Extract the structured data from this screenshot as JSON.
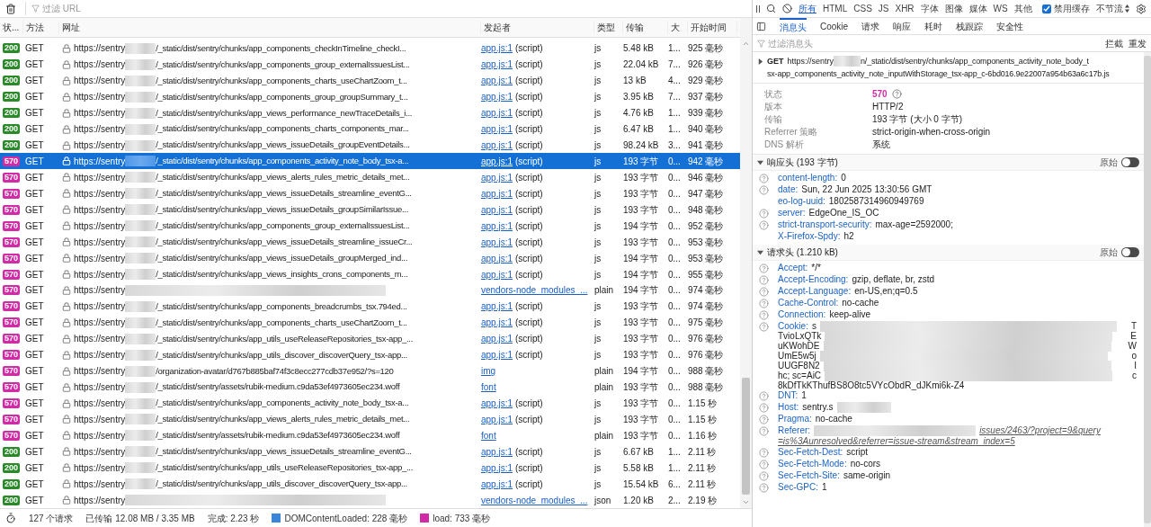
{
  "toolbar": {
    "filter_placeholder": "过滤 URL"
  },
  "columns": [
    "状...",
    "方法",
    "网址",
    "发起者",
    "类型",
    "传输",
    "大",
    "开始时间"
  ],
  "rows": [
    {
      "status": "200",
      "color": "#2a8a2a",
      "method": "GET",
      "url_start": "https://sentry",
      "url_end": "/_static/dist/sentry/chunks/app_components_checkInTimeline_checkI...",
      "initiator": "app.js:1",
      "initiator_note": "(script)",
      "type": "js",
      "transferred": "5.48 kB",
      "size": "1...",
      "start": "925 毫秒",
      "selected": false
    },
    {
      "status": "200",
      "color": "#2a8a2a",
      "method": "GET",
      "url_start": "https://sentry",
      "url_end": "/_static/dist/sentry/chunks/app_components_group_externalIssuesList...",
      "initiator": "app.js:1",
      "initiator_note": "(script)",
      "type": "js",
      "transferred": "22.04 kB",
      "size": "7...",
      "start": "926 毫秒",
      "selected": false
    },
    {
      "status": "200",
      "color": "#2a8a2a",
      "method": "GET",
      "url_start": "https://sentry",
      "url_end": "/_static/dist/sentry/chunks/app_components_charts_useChartZoom_t...",
      "initiator": "app.js:1",
      "initiator_note": "(script)",
      "type": "js",
      "transferred": "13 kB",
      "size": "4...",
      "start": "929 毫秒",
      "selected": false
    },
    {
      "status": "200",
      "color": "#2a8a2a",
      "method": "GET",
      "url_start": "https://sentry",
      "url_end": "/_static/dist/sentry/chunks/app_components_group_groupSummary_t...",
      "initiator": "app.js:1",
      "initiator_note": "(script)",
      "type": "js",
      "transferred": "3.95 kB",
      "size": "7...",
      "start": "937 毫秒",
      "selected": false
    },
    {
      "status": "200",
      "color": "#2a8a2a",
      "method": "GET",
      "url_start": "https://sentry",
      "url_end": "/_static/dist/sentry/chunks/app_views_performance_newTraceDetails_i...",
      "initiator": "app.js:1",
      "initiator_note": "(script)",
      "type": "js",
      "transferred": "4.76 kB",
      "size": "1...",
      "start": "939 毫秒",
      "selected": false
    },
    {
      "status": "200",
      "color": "#2a8a2a",
      "method": "GET",
      "url_start": "https://sentry",
      "url_end": "/_static/dist/sentry/chunks/app_components_charts_components_mar...",
      "initiator": "app.js:1",
      "initiator_note": "(script)",
      "type": "js",
      "transferred": "6.47 kB",
      "size": "1...",
      "start": "940 毫秒",
      "selected": false
    },
    {
      "status": "200",
      "color": "#2a8a2a",
      "method": "GET",
      "url_start": "https://sentry",
      "url_end": "/_static/dist/sentry/chunks/app_views_issueDetails_groupEventDetails...",
      "initiator": "app.js:1",
      "initiator_note": "(script)",
      "type": "js",
      "transferred": "98.24 kB",
      "size": "3...",
      "start": "941 毫秒",
      "selected": false
    },
    {
      "status": "570",
      "color": "#d12ba6",
      "method": "GET",
      "url_start": "https://sentry",
      "url_end": "/_static/dist/sentry/chunks/app_components_activity_note_body_tsx-a...",
      "initiator": "app.js:1",
      "initiator_note": "(script)",
      "type": "js",
      "transferred": "193 字节",
      "size": "0...",
      "start": "942 毫秒",
      "selected": true
    },
    {
      "status": "570",
      "color": "#d12ba6",
      "method": "GET",
      "url_start": "https://sentry",
      "url_end": "/_static/dist/sentry/chunks/app_views_alerts_rules_metric_details_met...",
      "initiator": "app.js:1",
      "initiator_note": "(script)",
      "type": "js",
      "transferred": "193 字节",
      "size": "0...",
      "start": "946 毫秒",
      "selected": false
    },
    {
      "status": "570",
      "color": "#d12ba6",
      "method": "GET",
      "url_start": "https://sentry",
      "url_end": "/_static/dist/sentry/chunks/app_views_issueDetails_streamline_eventG...",
      "initiator": "app.js:1",
      "initiator_note": "(script)",
      "type": "js",
      "transferred": "193 字节",
      "size": "0...",
      "start": "947 毫秒",
      "selected": false
    },
    {
      "status": "570",
      "color": "#d12ba6",
      "method": "GET",
      "url_start": "https://sentry",
      "url_end": "/_static/dist/sentry/chunks/app_views_issueDetails_groupSimilarIssue...",
      "initiator": "app.js:1",
      "initiator_note": "(script)",
      "type": "js",
      "transferred": "193 字节",
      "size": "0...",
      "start": "948 毫秒",
      "selected": false
    },
    {
      "status": "570",
      "color": "#d12ba6",
      "method": "GET",
      "url_start": "https://sentry",
      "url_end": "/_static/dist/sentry/chunks/app_components_group_externalIssuesList...",
      "initiator": "app.js:1",
      "initiator_note": "(script)",
      "type": "js",
      "transferred": "194 字节",
      "size": "0...",
      "start": "952 毫秒",
      "selected": false
    },
    {
      "status": "570",
      "color": "#d12ba6",
      "method": "GET",
      "url_start": "https://sentry",
      "url_end": "/_static/dist/sentry/chunks/app_views_issueDetails_streamline_issueCr...",
      "initiator": "app.js:1",
      "initiator_note": "(script)",
      "type": "js",
      "transferred": "193 字节",
      "size": "0...",
      "start": "953 毫秒",
      "selected": false
    },
    {
      "status": "570",
      "color": "#d12ba6",
      "method": "GET",
      "url_start": "https://sentry",
      "url_end": "/_static/dist/sentry/chunks/app_views_issueDetails_groupMerged_ind...",
      "initiator": "app.js:1",
      "initiator_note": "(script)",
      "type": "js",
      "transferred": "194 字节",
      "size": "0...",
      "start": "953 毫秒",
      "selected": false
    },
    {
      "status": "570",
      "color": "#d12ba6",
      "method": "GET",
      "url_start": "https://sentry",
      "url_end": "/_static/dist/sentry/chunks/app_views_insights_crons_components_m...",
      "initiator": "app.js:1",
      "initiator_note": "(script)",
      "type": "js",
      "transferred": "194 字节",
      "size": "0...",
      "start": "955 毫秒",
      "selected": false
    },
    {
      "status": "570",
      "color": "#d12ba6",
      "method": "GET",
      "url_start": "https://sentry",
      "initiator": "vendors-node_modules_...",
      "type": "plain",
      "transferred": "194 字节",
      "size": "0...",
      "start": "974 毫秒",
      "selected": false
    },
    {
      "status": "570",
      "color": "#d12ba6",
      "method": "GET",
      "url_start": "https://sentry",
      "url_end": "/_static/dist/sentry/chunks/app_components_breadcrumbs_tsx.794ed...",
      "initiator": "app.js:1",
      "initiator_note": "(script)",
      "type": "js",
      "transferred": "193 字节",
      "size": "0...",
      "start": "974 毫秒",
      "selected": false
    },
    {
      "status": "570",
      "color": "#d12ba6",
      "method": "GET",
      "url_start": "https://sentry",
      "url_end": "/_static/dist/sentry/chunks/app_components_charts_useChartZoom_t...",
      "initiator": "app.js:1",
      "initiator_note": "(script)",
      "type": "js",
      "transferred": "193 字节",
      "size": "0...",
      "start": "975 毫秒",
      "selected": false
    },
    {
      "status": "570",
      "color": "#d12ba6",
      "method": "GET",
      "url_start": "https://sentry",
      "url_end": "/_static/dist/sentry/chunks/app_utils_useReleaseRepositories_tsx-app_...",
      "initiator": "app.js:1",
      "initiator_note": "(script)",
      "type": "js",
      "transferred": "193 字节",
      "size": "0...",
      "start": "976 毫秒",
      "selected": false
    },
    {
      "status": "570",
      "color": "#d12ba6",
      "method": "GET",
      "url_start": "https://sentry",
      "url_end": "/_static/dist/sentry/chunks/app_utils_discover_discoverQuery_tsx-app...",
      "initiator": "app.js:1",
      "initiator_note": "(script)",
      "type": "js",
      "transferred": "193 字节",
      "size": "0...",
      "start": "976 毫秒",
      "selected": false
    },
    {
      "status": "570",
      "color": "#d12ba6",
      "method": "GET",
      "url_start": "https://sentry",
      "url_end": "/organization-avatar/d767b885baf74f3c8ecc277cdb37e952/?s=120",
      "initiator": "img",
      "type": "plain",
      "transferred": "194 字节",
      "size": "0...",
      "start": "988 毫秒",
      "selected": false
    },
    {
      "status": "570",
      "color": "#d12ba6",
      "method": "GET",
      "url_start": "https://sentry",
      "url_end": "/_static/dist/sentry/assets/rubik-medium.c9da53ef4973605ec234.woff",
      "initiator": "font",
      "type": "plain",
      "transferred": "193 字节",
      "size": "0...",
      "start": "988 毫秒",
      "selected": false
    },
    {
      "status": "570",
      "color": "#d12ba6",
      "method": "GET",
      "url_start": "https://sentry",
      "url_end": "/_static/dist/sentry/chunks/app_components_activity_note_body_tsx-a...",
      "initiator": "app.js:1",
      "initiator_note": "(script)",
      "type": "js",
      "transferred": "193 字节",
      "size": "0...",
      "start": "1.15 秒",
      "selected": false
    },
    {
      "status": "570",
      "color": "#d12ba6",
      "method": "GET",
      "url_start": "https://sentry",
      "url_end": "/_static/dist/sentry/chunks/app_views_alerts_rules_metric_details_met...",
      "initiator": "app.js:1",
      "initiator_note": "(script)",
      "type": "js",
      "transferred": "193 字节",
      "size": "0...",
      "start": "1.15 秒",
      "selected": false
    },
    {
      "status": "570",
      "color": "#d12ba6",
      "method": "GET",
      "url_start": "https://sentry",
      "url_end": "/_static/dist/sentry/assets/rubik-medium.c9da53ef4973605ec234.woff",
      "initiator": "font",
      "type": "plain",
      "transferred": "193 字节",
      "size": "0...",
      "start": "1.16 秒",
      "selected": false
    },
    {
      "status": "200",
      "color": "#2a8a2a",
      "method": "GET",
      "url_start": "https://sentry",
      "url_end": "/_static/dist/sentry/chunks/app_views_issueDetails_streamline_eventG...",
      "initiator": "app.js:1",
      "initiator_note": "(script)",
      "type": "js",
      "transferred": "6.67 kB",
      "size": "1...",
      "start": "2.11 秒",
      "selected": false
    },
    {
      "status": "200",
      "color": "#2a8a2a",
      "method": "GET",
      "url_start": "https://sentry",
      "url_end": "/_static/dist/sentry/chunks/app_utils_useReleaseRepositories_tsx-app_...",
      "initiator": "app.js:1",
      "initiator_note": "(script)",
      "type": "js",
      "transferred": "5.58 kB",
      "size": "1...",
      "start": "2.11 秒",
      "selected": false
    },
    {
      "status": "200",
      "color": "#2a8a2a",
      "method": "GET",
      "url_start": "https://sentry",
      "url_end": "/_static/dist/sentry/chunks/app_utils_discover_discoverQuery_tsx-app...",
      "initiator": "app.js:1",
      "initiator_note": "(script)",
      "type": "js",
      "transferred": "15.54 kB",
      "size": "6...",
      "start": "2.11 秒",
      "selected": false
    },
    {
      "status": "200",
      "color": "#2a8a2a",
      "method": "GET",
      "url_start": "https://sentry",
      "initiator": "vendors-node_modules_...",
      "type": "json",
      "transferred": "1.20 kB",
      "size": "2...",
      "start": "2.19 秒",
      "selected": false
    }
  ],
  "status_bar": {
    "requests": "127 个请求",
    "transferred": "已传输 12.08 MB / 3.35 MB",
    "finish": "完成: 2.23 秒",
    "dom": "DOMContentLoaded: 228 毫秒",
    "load": "load: 733 毫秒"
  },
  "filter_tabs": [
    {
      "label": "所有",
      "selected": true
    },
    {
      "label": "HTML",
      "selected": false
    },
    {
      "label": "CSS",
      "selected": false
    },
    {
      "label": "JS",
      "selected": false
    },
    {
      "label": "XHR",
      "selected": false
    },
    {
      "label": "字体",
      "selected": false
    },
    {
      "label": "图像",
      "selected": false
    },
    {
      "label": "媒体",
      "selected": false
    },
    {
      "label": "WS",
      "selected": false
    },
    {
      "label": "其他",
      "selected": false
    }
  ],
  "disable_cache": {
    "label": "禁用缓存",
    "checked": true
  },
  "throttle": "不节流",
  "detail_tabs": [
    {
      "label": "消息头",
      "selected": true
    },
    {
      "label": "Cookie",
      "selected": false
    },
    {
      "label": "请求",
      "selected": false
    },
    {
      "label": "响应",
      "selected": false
    },
    {
      "label": "耗时",
      "selected": false
    },
    {
      "label": "栈跟踪",
      "selected": false
    },
    {
      "label": "安全性",
      "selected": false
    }
  ],
  "header_filter_placeholder": "过滤消息头",
  "actions": [
    "拦截",
    "重发"
  ],
  "request": {
    "expanded": false,
    "method": "GET",
    "url_start": "https://sentry",
    "url_lines": [
      "n/_static/dist/sentry/chunks/app_components_activity_note_body_t",
      "sx-app_components_activity_note_inputWithStorage_tsx-app_c-6bd016.9e22007a954b63a6c17b.js"
    ]
  },
  "summary": [
    {
      "label": "状态",
      "value": "570",
      "kind": "status"
    },
    {
      "label": "版本",
      "value": "HTTP/2",
      "kind": "text"
    },
    {
      "label": "传输",
      "value": "193 字节 (大小 0 字节)",
      "kind": "text"
    },
    {
      "label": "Referrer 策略",
      "value": "strict-origin-when-cross-origin",
      "kind": "text"
    },
    {
      "label": "DNS 解析",
      "value": "系统",
      "kind": "text"
    }
  ],
  "sections": [
    {
      "title": "响应头 (193 字节)",
      "expanded": true,
      "raw_label": "原始",
      "raw_on": false,
      "headers": [
        {
          "kind": "plain",
          "help": true,
          "name": "content-length:",
          "value": "0"
        },
        {
          "kind": "plain",
          "help": true,
          "name": "date:",
          "value": "Sun, 22 Jun 2025 13:30:56 GMT"
        },
        {
          "kind": "plain",
          "help": false,
          "name": "eo-log-uuid:",
          "value": "1802587314960949769"
        },
        {
          "kind": "plain",
          "help": true,
          "name": "server:",
          "value": "EdgeOne_IS_OC"
        },
        {
          "kind": "plain",
          "help": true,
          "name": "strict-transport-security:",
          "value": "max-age=2592000;"
        },
        {
          "kind": "plain",
          "help": false,
          "name": "X-Firefox-Spdy:",
          "value": "h2"
        }
      ]
    },
    {
      "title": "请求头 (1.210 kB)",
      "expanded": true,
      "raw_label": "原始",
      "raw_on": false,
      "headers": [
        {
          "kind": "plain",
          "help": true,
          "name": "Accept:",
          "value": "*/*"
        },
        {
          "kind": "plain",
          "help": true,
          "name": "Accept-Encoding:",
          "value": "gzip, deflate, br, zstd"
        },
        {
          "kind": "plain",
          "help": true,
          "name": "Accept-Language:",
          "value": "en-US,en;q=0.5"
        },
        {
          "kind": "plain",
          "help": true,
          "name": "Cache-Control:",
          "value": "no-cache"
        },
        {
          "kind": "plain",
          "help": true,
          "name": "Connection:",
          "value": "keep-alive"
        },
        {
          "kind": "redacted",
          "help": true,
          "name": "Cookie:",
          "lines": [
            {
              "start": "s",
              "end": "T"
            },
            {
              "start": "TvioLxQTk",
              "end": "E"
            },
            {
              "start": "uKWohDE",
              "end": "W"
            },
            {
              "start": "UmE5w5j",
              "end": "o"
            },
            {
              "start": "UUGF8N2",
              "end": "I"
            },
            {
              "start": "hc; sc=AiC",
              "end": "c"
            },
            {
              "start": "8kDfTkKThufBS8O8tc5VYcObdR_dJKmi6k-Z4"
            }
          ]
        },
        {
          "kind": "plain",
          "help": true,
          "name": "DNT:",
          "value": "1"
        },
        {
          "kind": "tail",
          "help": true,
          "name": "Host:",
          "value": "sentry.s"
        },
        {
          "kind": "plain",
          "help": true,
          "name": "Pragma:",
          "value": "no-cache"
        },
        {
          "kind": "link",
          "help": true,
          "name": "Referer:",
          "lines": [
            "issues/2463/?project=9&query",
            "=is%3Aunresolved&referrer=issue-stream&stream_index=5"
          ]
        },
        {
          "kind": "plain",
          "help": true,
          "name": "Sec-Fetch-Dest:",
          "value": "script"
        },
        {
          "kind": "plain",
          "help": true,
          "name": "Sec-Fetch-Mode:",
          "value": "no-cors"
        },
        {
          "kind": "plain",
          "help": true,
          "name": "Sec-Fetch-Site:",
          "value": "same-origin"
        },
        {
          "kind": "plain",
          "help": true,
          "name": "Sec-GPC:",
          "value": "1"
        }
      ]
    }
  ]
}
